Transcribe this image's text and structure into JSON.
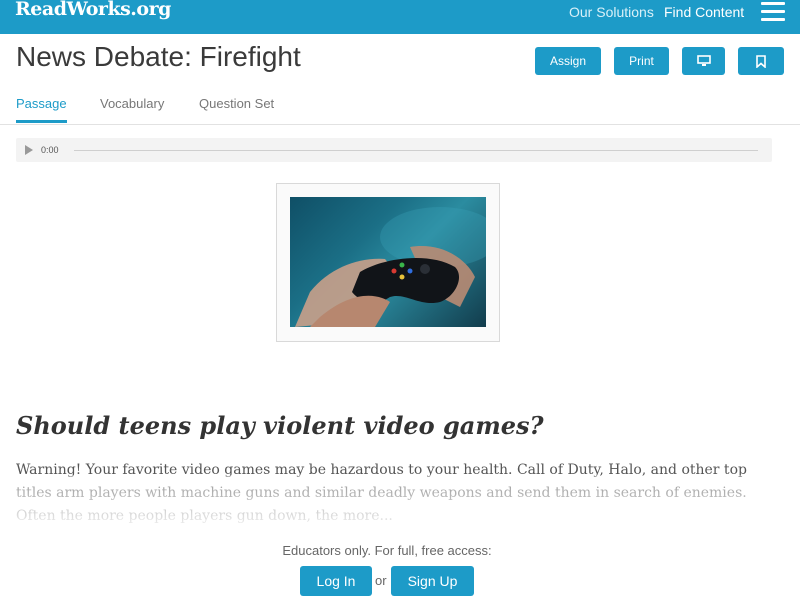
{
  "header": {
    "logo": "ReadWorks.org",
    "nav": {
      "solutions": "Our Solutions",
      "find_content": "Find Content"
    }
  },
  "page": {
    "title": "News Debate: Firefight",
    "buttons": {
      "assign": "Assign",
      "print": "Print"
    }
  },
  "tabs": [
    "Passage",
    "Vocabulary",
    "Question Set"
  ],
  "audio": {
    "time": "0:00"
  },
  "article": {
    "question": "Should teens play violent video games?",
    "paragraph": "Warning! Your favorite video games may be hazardous to your health. Call of Duty, Halo, and other top titles arm players with machine guns and similar deadly weapons and send them in search of enemies. Often the more people players gun down, the more..."
  },
  "access": {
    "educators_text": "Educators only. For full, free access:",
    "login": "Log In",
    "or": "or",
    "signup": "Sign Up"
  },
  "colors": {
    "brand": "#1d9bc8",
    "text_dark": "#3a3a3a"
  }
}
